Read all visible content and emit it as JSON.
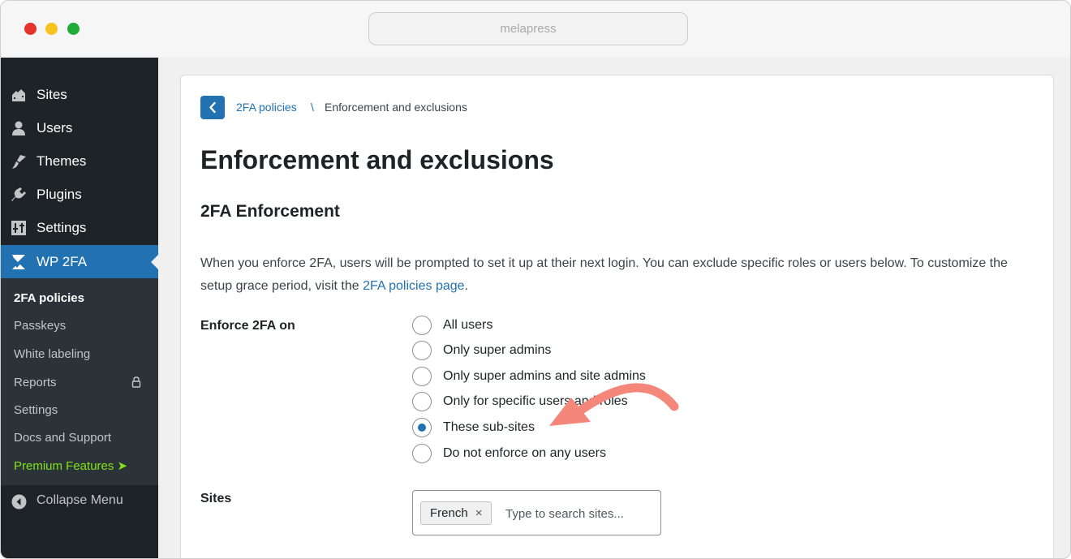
{
  "browser": {
    "url": "melapress"
  },
  "sidebar": {
    "items": [
      {
        "label": "Sites",
        "icon": "sites-icon"
      },
      {
        "label": "Users",
        "icon": "users-icon"
      },
      {
        "label": "Themes",
        "icon": "themes-icon"
      },
      {
        "label": "Plugins",
        "icon": "plugins-icon"
      },
      {
        "label": "Settings",
        "icon": "settings-icon"
      },
      {
        "label": "WP 2FA",
        "icon": "wp2fa-icon"
      }
    ],
    "submenu": [
      {
        "label": "2FA policies"
      },
      {
        "label": "Passkeys"
      },
      {
        "label": "White labeling"
      },
      {
        "label": "Reports"
      },
      {
        "label": "Settings"
      },
      {
        "label": "Docs and Support"
      },
      {
        "label": "Premium Features ➤"
      }
    ],
    "collapse_label": "Collapse Menu"
  },
  "breadcrumb": {
    "parent": "2FA policies",
    "separator": "\\",
    "current": "Enforcement and exclusions"
  },
  "page_title": "Enforcement and exclusions",
  "section_title": "2FA Enforcement",
  "description": {
    "text_before": "When you enforce 2FA, users will be prompted to set it up at their next login. You can exclude specific roles or users below. To customize the setup grace period, visit the ",
    "link": "2FA policies page",
    "text_after": "."
  },
  "enforce": {
    "label": "Enforce 2FA on",
    "options": [
      {
        "label": "All users",
        "checked": false
      },
      {
        "label": "Only super admins",
        "checked": false
      },
      {
        "label": "Only super admins and site admins",
        "checked": false
      },
      {
        "label": "Only for specific users and roles",
        "checked": false
      },
      {
        "label": "These sub-sites",
        "checked": true
      },
      {
        "label": "Do not enforce on any users",
        "checked": false
      }
    ]
  },
  "sites": {
    "label": "Sites",
    "tag": "French",
    "tag_remove": "×",
    "placeholder": "Type to search sites..."
  },
  "colors": {
    "admin_bar": "#1d2327",
    "submenu": "#2c3338",
    "accent": "#2271b1",
    "premium": "#7fe31a",
    "annotation_arrow": "#f4877a"
  }
}
